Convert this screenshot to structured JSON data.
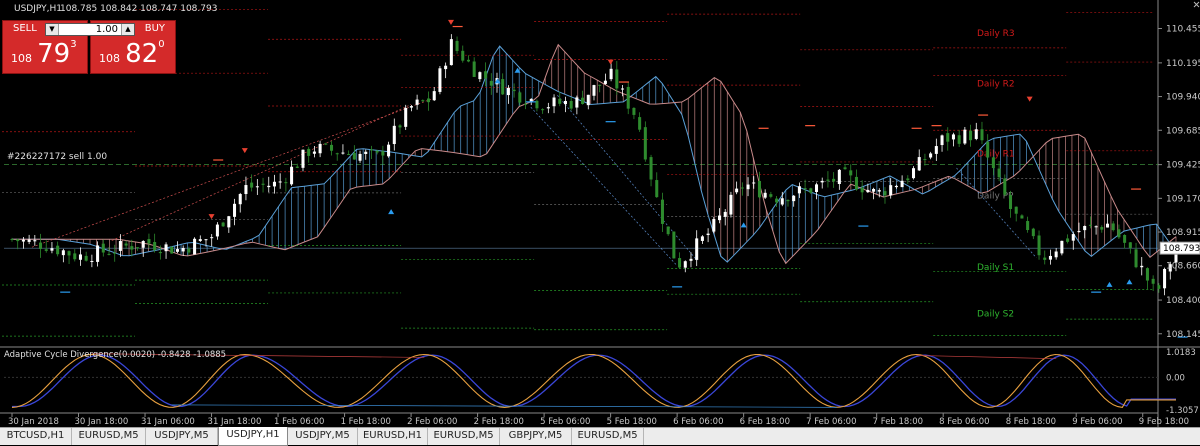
{
  "window": {
    "title": "USDJPY,H1",
    "ohlc": "108.785 108.842 108.747 108.793",
    "close_icon": "close-x-icon"
  },
  "trade_panel": {
    "sell_label": "SELL",
    "buy_label": "BUY",
    "lot": "1.00",
    "sell_price": {
      "prefix": "108",
      "big": "79",
      "sup": "3"
    },
    "buy_price": {
      "prefix": "108",
      "big": "82",
      "sup": "0"
    }
  },
  "order_line_label": "#226227172 sell 1.00",
  "price_axis": {
    "labels": [
      "110.455",
      "110.195",
      "109.940",
      "109.685",
      "109.425",
      "109.170",
      "108.915",
      "108.660",
      "108.400",
      "108.145"
    ],
    "current_price": "108.793"
  },
  "pivots": [
    {
      "label": "Daily R3",
      "color": "#d11a1a"
    },
    {
      "label": "Daily R2",
      "color": "#d11a1a"
    },
    {
      "label": "Daily R1",
      "color": "#d11a1a"
    },
    {
      "label": "Daily PP",
      "color": "#777777"
    },
    {
      "label": "Daily S1",
      "color": "#2fb52f"
    },
    {
      "label": "Daily S2",
      "color": "#2fb52f"
    }
  ],
  "indicator": {
    "title": "Adaptive Cycle Divergence(0.0020) -0.8428 -1.0885",
    "axis_labels": [
      "1.0183",
      "0.00",
      "-1.3057"
    ]
  },
  "time_axis": [
    "30 Jan 2018",
    "30 Jan 18:00",
    "31 Jan 06:00",
    "31 Jan 18:00",
    "1 Feb 06:00",
    "1 Feb 18:00",
    "2 Feb 06:00",
    "2 Feb 18:00",
    "5 Feb 06:00",
    "5 Feb 18:00",
    "6 Feb 06:00",
    "6 Feb 18:00",
    "7 Feb 06:00",
    "7 Feb 18:00",
    "8 Feb 06:00",
    "8 Feb 18:00",
    "9 Feb 06:00",
    "9 Feb 18:00"
  ],
  "tabs": [
    {
      "label": "BTCUSD,H1",
      "active": false
    },
    {
      "label": "EURUSD,M5",
      "active": false
    },
    {
      "label": "USDJPY,M5",
      "active": false
    },
    {
      "label": "USDJPY,H1",
      "active": true
    },
    {
      "label": "USDJPY,M5",
      "active": false
    },
    {
      "label": "EURUSD,H1",
      "active": false
    },
    {
      "label": "EURUSD,M5",
      "active": false
    },
    {
      "label": "GBPJPY,M5",
      "active": false
    },
    {
      "label": "EURUSD,M5",
      "active": false
    }
  ],
  "colors": {
    "background": "#000000",
    "bull_candle": "#ffffff",
    "bear_candle": "#2e8b2e",
    "cloud_up": "#5aa0d8",
    "cloud_down": "#c98a8a",
    "sell_button": "#d42a2a",
    "grid": "#1c1c1c",
    "axis_text": "#c8c8c8"
  },
  "chart_data": {
    "type": "candlestick",
    "symbol": "USDJPY",
    "timeframe": "H1",
    "ylim": [
      108.06,
      110.58
    ],
    "x_categories": [
      "30 Jan 2018",
      "30 Jan 18:00",
      "31 Jan 06:00",
      "31 Jan 18:00",
      "1 Feb 06:00",
      "1 Feb 18:00",
      "2 Feb 06:00",
      "2 Feb 18:00",
      "5 Feb 06:00",
      "5 Feb 18:00",
      "6 Feb 06:00",
      "6 Feb 18:00",
      "7 Feb 06:00",
      "7 Feb 18:00",
      "8 Feb 06:00",
      "8 Feb 18:00",
      "9 Feb 06:00",
      "9 Feb 18:00"
    ],
    "close_path": [
      [
        0,
        108.86
      ],
      [
        0.5,
        108.82
      ],
      [
        1,
        108.73
      ],
      [
        1.5,
        108.78
      ],
      [
        2,
        108.84
      ],
      [
        2.5,
        108.78
      ],
      [
        3,
        108.88
      ],
      [
        3.5,
        109.25
      ],
      [
        4,
        109.28
      ],
      [
        4.5,
        109.55
      ],
      [
        5,
        109.52
      ],
      [
        5.5,
        109.48
      ],
      [
        6,
        109.86
      ],
      [
        6.3,
        109.92
      ],
      [
        6.6,
        110.34
      ],
      [
        7,
        110.12
      ],
      [
        7.5,
        109.98
      ],
      [
        8,
        109.88
      ],
      [
        8.5,
        109.9
      ],
      [
        9,
        110.1
      ],
      [
        9.4,
        109.78
      ],
      [
        9.7,
        109.15
      ],
      [
        10,
        108.66
      ],
      [
        10.5,
        108.92
      ],
      [
        11,
        109.28
      ],
      [
        11.5,
        109.18
      ],
      [
        12,
        109.24
      ],
      [
        12.5,
        109.34
      ],
      [
        13,
        109.2
      ],
      [
        13.5,
        109.35
      ],
      [
        14,
        109.62
      ],
      [
        14.5,
        109.66
      ],
      [
        15,
        109.1
      ],
      [
        15.5,
        108.72
      ],
      [
        16,
        108.92
      ],
      [
        16.5,
        108.98
      ],
      [
        17,
        108.62
      ],
      [
        17.2,
        108.44
      ],
      [
        17.5,
        108.79
      ]
    ],
    "pivot_levels": [
      {
        "name": "Daily R3",
        "value": 110.42
      },
      {
        "name": "Daily R2",
        "value": 110.04
      },
      {
        "name": "Daily R1",
        "value": 109.51
      },
      {
        "name": "Daily PP",
        "value": 109.19
      },
      {
        "name": "Daily S1",
        "value": 108.65
      },
      {
        "name": "Daily S2",
        "value": 108.3
      }
    ],
    "order_line": 109.425,
    "current_price": 108.793,
    "indicator": {
      "name": "Adaptive Cycle Divergence",
      "ylim": [
        -1.3057,
        1.0183
      ],
      "peaks": [
        1.2,
        3.5,
        6.2,
        8.7,
        11.2,
        13.6,
        15.7
      ],
      "troughs": [
        0,
        2.4,
        4.9,
        7.4,
        10.0,
        12.4,
        14.7,
        16.7
      ]
    }
  }
}
